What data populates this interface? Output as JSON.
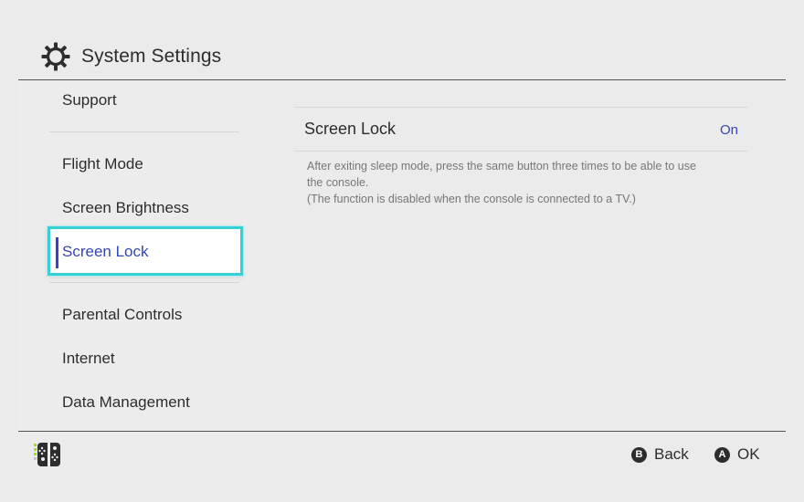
{
  "header": {
    "title": "System Settings",
    "icon": "gear-icon"
  },
  "sidebar": {
    "items": [
      {
        "label": "Support"
      },
      {
        "label": "Flight Mode"
      },
      {
        "label": "Screen Brightness"
      },
      {
        "label": "Screen Lock",
        "selected": true
      },
      {
        "label": "Parental Controls"
      },
      {
        "label": "Internet"
      },
      {
        "label": "Data Management"
      }
    ]
  },
  "main": {
    "setting": {
      "label": "Screen Lock",
      "value": "On",
      "description_line1": "After exiting sleep mode, press the same button three times to be able to use",
      "description_line2": "the console.",
      "description_line3": "(The function is disabled when the console is connected to a TV.)"
    }
  },
  "footer": {
    "controller_icon": "joycon-icon",
    "back": {
      "button": "B",
      "label": "Back"
    },
    "ok": {
      "button": "A",
      "label": "OK"
    }
  },
  "colors": {
    "accent": "#3546b8",
    "selection_border": "#38d0d6",
    "background": "#ebebeb",
    "joycon_green": "#9be21d"
  }
}
